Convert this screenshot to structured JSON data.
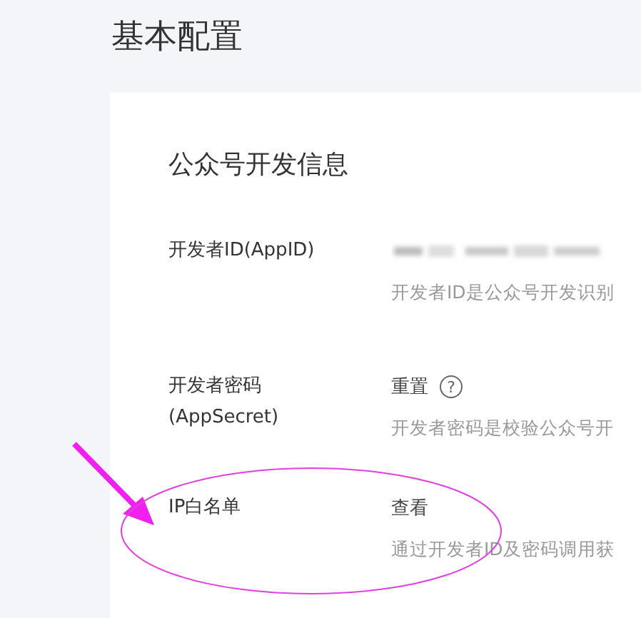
{
  "page_title": "基本配置",
  "section_title": "公众号开发信息",
  "rows": [
    {
      "kind": "masked",
      "label": [
        "开发者ID(AppID)"
      ],
      "description": "开发者ID是公众号开发识别"
    },
    {
      "kind": "action",
      "label": [
        "开发者密码",
        "(AppSecret)"
      ],
      "action": "重置",
      "help": "?",
      "description": "开发者密码是校验公众号开"
    },
    {
      "kind": "action",
      "label": [
        "IP白名单"
      ],
      "action": "查看",
      "description": "通过开发者ID及密码调用获"
    }
  ]
}
